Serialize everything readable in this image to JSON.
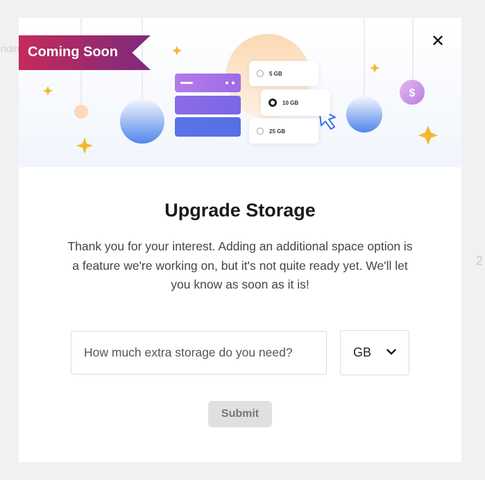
{
  "background": {
    "left_fragment": "Pending",
    "right_fragment": "2"
  },
  "modal": {
    "badge": "Coming Soon",
    "close_icon": "close-icon",
    "illustration": {
      "options": [
        {
          "label": "5 GB",
          "selected": false
        },
        {
          "label": "10 GB",
          "selected": true
        },
        {
          "label": "25 GB",
          "selected": false
        }
      ],
      "coin_symbol": "$"
    },
    "title": "Upgrade Storage",
    "description": "Thank you for your interest. Adding an additional space option is a feature we're working on, but it's not quite ready yet. We'll let you know as soon as it is!",
    "storage_input": {
      "placeholder": "How much extra storage do you need?",
      "value": ""
    },
    "unit_select": {
      "value": "GB",
      "icon": "chevron-down-icon"
    },
    "submit_label": "Submit"
  },
  "colors": {
    "badge_gradient_start": "#c42b59",
    "badge_gradient_end": "#7e2a7e",
    "server_purple": "#9b6de0",
    "server_blue": "#5b73e8",
    "submit_bg": "#e0e0e0",
    "star": "#f5b731"
  }
}
